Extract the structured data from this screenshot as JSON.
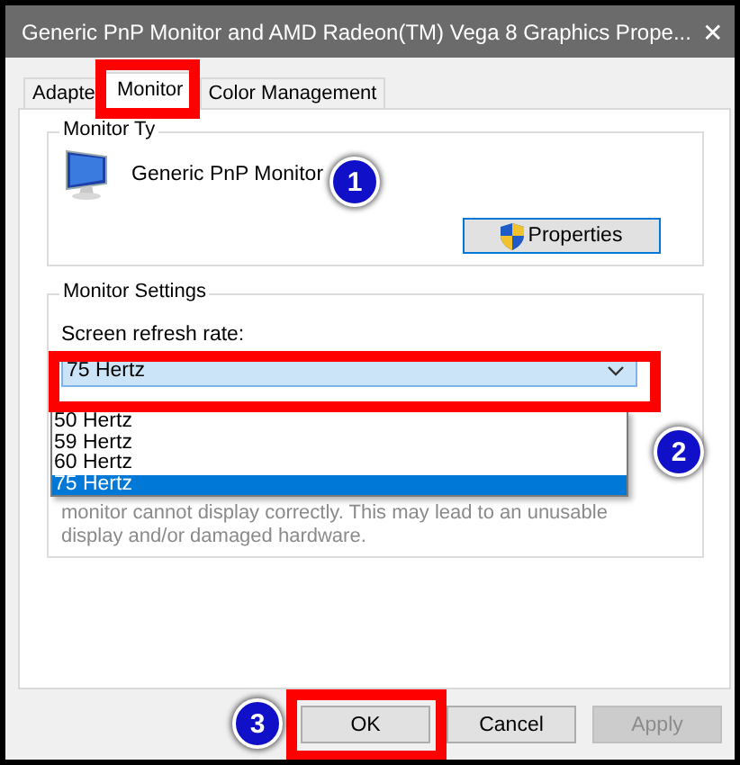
{
  "window": {
    "title": "Generic PnP Monitor and AMD Radeon(TM) Vega 8 Graphics Prope...",
    "close": "✕"
  },
  "tabs": [
    {
      "label": "Adapte",
      "selected": false
    },
    {
      "label": "Monitor",
      "selected": true
    },
    {
      "label": "Color Management",
      "selected": false
    }
  ],
  "monitor_type": {
    "label": "Monitor Ty",
    "name": "Generic PnP Monitor",
    "button": "Properties"
  },
  "monitor_settings": {
    "label": "Monitor Settings",
    "refresh_label": "Screen refresh rate:",
    "refresh_value": "75 Hertz",
    "options": [
      {
        "label": "50 Hertz",
        "selected": false
      },
      {
        "label": "59 Hertz",
        "selected": false
      },
      {
        "label": "60 Hertz",
        "selected": false
      },
      {
        "label": "75 Hertz",
        "selected": true
      }
    ],
    "warning": [
      "monitor cannot display correctly. This may lead to an unusable",
      "display and/or damaged hardware."
    ]
  },
  "buttons": [
    {
      "label": "OK",
      "disabled": false
    },
    {
      "label": "Cancel",
      "disabled": false
    },
    {
      "label": "Apply",
      "disabled": true
    }
  ],
  "callouts": [
    {
      "label": "1"
    },
    {
      "label": "2"
    },
    {
      "label": "3"
    }
  ]
}
